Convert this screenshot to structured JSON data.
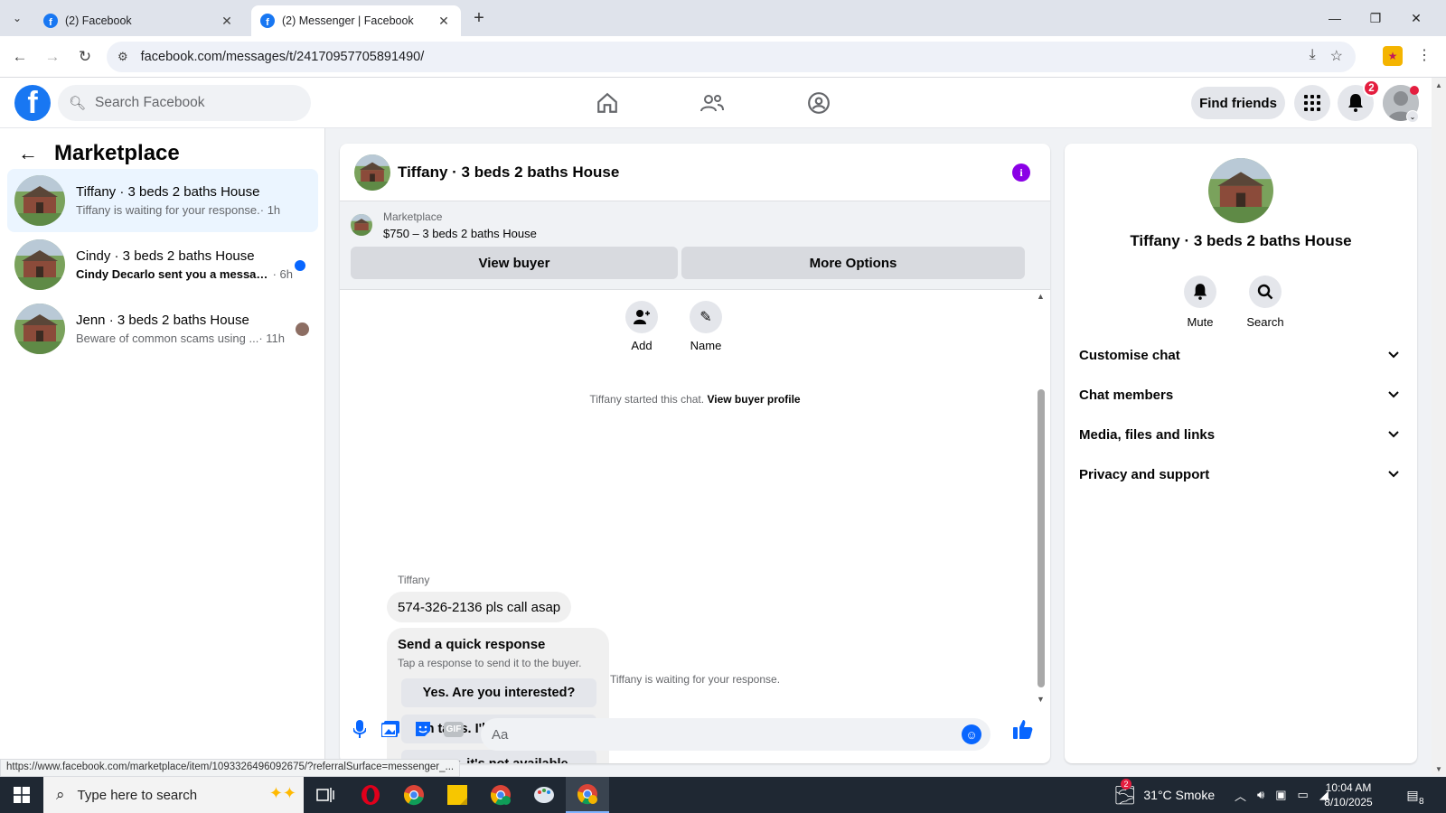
{
  "browser": {
    "tabs": [
      {
        "title": "(2) Facebook",
        "active": false
      },
      {
        "title": "(2) Messenger | Facebook",
        "active": true
      }
    ],
    "url": "facebook.com/messages/t/24170957705891490/",
    "status_url": "https://www.facebook.com/marketplace/item/1093326496092675/?referralSurface=messenger_..."
  },
  "header": {
    "logo": "f",
    "search_placeholder": "Search Facebook",
    "find_friends": "Find friends",
    "notification_count": "2"
  },
  "sidebar": {
    "title": "Marketplace",
    "conversations": [
      {
        "name": "Tiffany · 3 beds 2 baths House",
        "preview": "Tiffany is waiting for your response.",
        "time": "· 1h",
        "active": true,
        "unread": false
      },
      {
        "name": "Cindy · 3 beds 2 baths House",
        "preview": "Cindy Decarlo sent you a message ...",
        "time": "· 6h",
        "active": false,
        "unread": true
      },
      {
        "name": "Jenn · 3 beds 2 baths House",
        "preview": "Beware of common scams using ...",
        "time": "· 11h",
        "active": false,
        "unread": false
      }
    ]
  },
  "chat": {
    "title": "Tiffany · 3 beds 2 baths House",
    "listing_source": "Marketplace",
    "listing_price": "$750 – 3 beds 2 baths House",
    "view_buyer": "View buyer",
    "more_options": "More Options",
    "add_label": "Add",
    "name_label": "Name",
    "started_text": "Tiffany started this chat.",
    "view_buyer_profile": "View buyer profile",
    "sender": "Tiffany",
    "message": "574-326-2136 pls call asap",
    "quick_title": "Send a quick response",
    "quick_subtitle": "Tap a response to send it to the buyer.",
    "quick_responses": [
      "Yes. Are you interested?",
      "In talks. I'll let you know.",
      "Sorry, it's not available."
    ],
    "waiting_text": "Tiffany is waiting for your response.",
    "composer_placeholder": "Aa",
    "gif_label": "GIF"
  },
  "details": {
    "title": "Tiffany · 3 beds 2 baths House",
    "mute": "Mute",
    "search": "Search",
    "sections": [
      "Customise chat",
      "Chat members",
      "Media, files and links",
      "Privacy and support"
    ]
  },
  "taskbar": {
    "search_placeholder": "Type here to search",
    "weather": "31°C  Smoke",
    "weather_badge": "2",
    "time": "10:04 AM",
    "date": "8/10/2025",
    "notif_count": "8"
  },
  "colors": {
    "facebook_blue": "#1877f2",
    "messenger_blue": "#0866ff",
    "info_purple": "#8a00e6",
    "badge_red": "#e41e3f"
  }
}
